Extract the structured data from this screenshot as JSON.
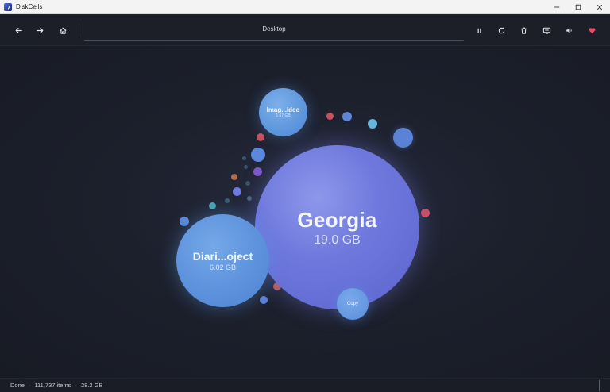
{
  "window": {
    "title": "DiskCells",
    "controls": [
      "minimize-icon",
      "maximize-icon",
      "close-icon"
    ]
  },
  "toolbar": {
    "location": "Desktop",
    "scan_progress": 1.0,
    "left_buttons": [
      "back-arrow-icon",
      "forward-arrow-icon",
      "home-icon"
    ],
    "right_buttons": [
      "pause-icon",
      "refresh-icon",
      "trash-icon",
      "display-icon",
      "sound-icon",
      "heart-icon"
    ],
    "heart_color": "#e84a6a"
  },
  "cells": {
    "georgia": {
      "name": "Georgia",
      "size": "19.0 GB"
    },
    "diari": {
      "name": "Diari...oject",
      "size": "6.02 GB"
    },
    "imag": {
      "name": "Imag...ideo",
      "size": "1.67 GB"
    },
    "copy": {
      "name": "Copy"
    }
  },
  "colors": {
    "background": "#1a1d26",
    "cell_primary": "#6f79dd",
    "cell_blue": "#5d92dc",
    "dot_red": "#d0505e",
    "dot_teal": "#5bb8c8"
  },
  "status": {
    "state": "Done",
    "items": "111,737 items",
    "total": "28.2 GB",
    "separator": "·"
  }
}
